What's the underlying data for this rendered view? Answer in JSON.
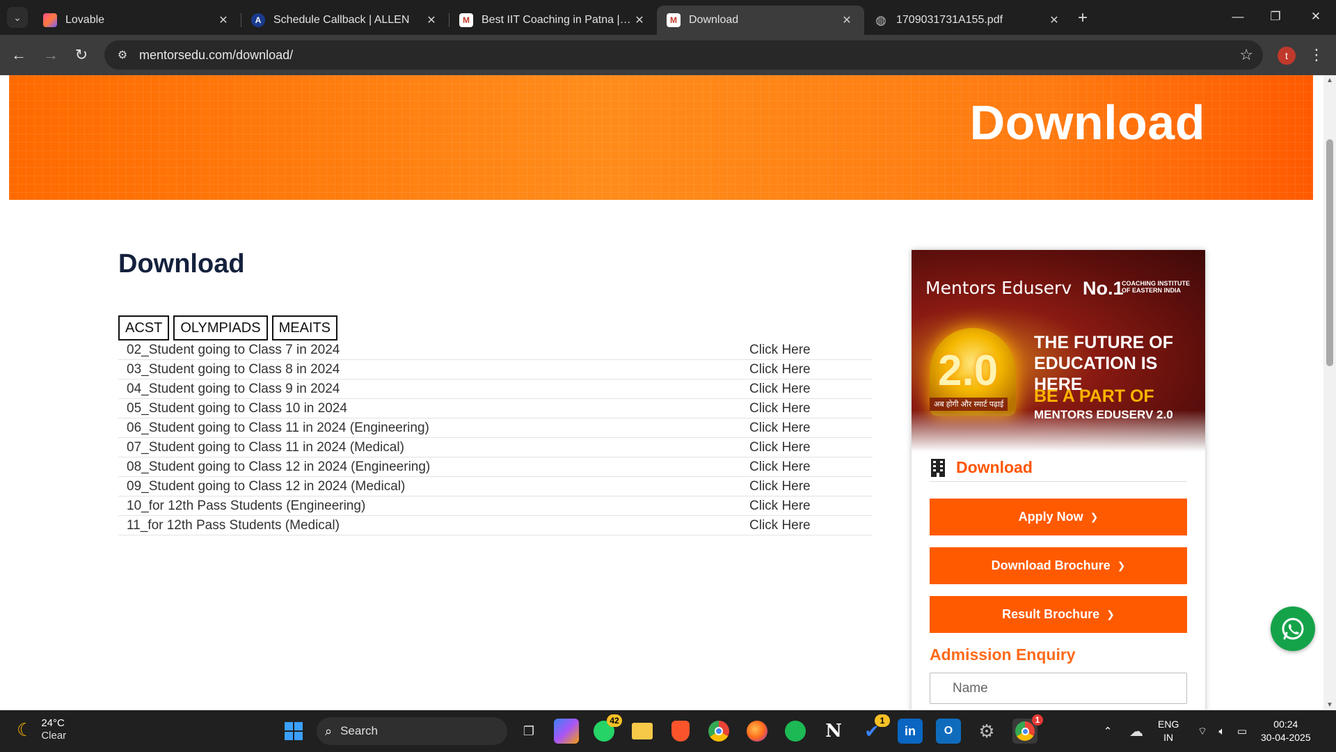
{
  "browser": {
    "tabs": [
      {
        "title": "Lovable",
        "active": false
      },
      {
        "title": "Schedule Callback | ALLEN",
        "active": false
      },
      {
        "title": "Best IIT Coaching in Patna | Best",
        "active": false
      },
      {
        "title": "Download",
        "active": true
      },
      {
        "title": "1709031731A155.pdf",
        "active": false
      }
    ],
    "url": "mentorsedu.com/download/",
    "profile_initial": "t"
  },
  "hero": {
    "title": "Download"
  },
  "main": {
    "heading": "Download",
    "categories": [
      "ACST",
      "OLYMPIADS",
      "MEAITS"
    ],
    "rows": [
      {
        "label": "02_Student going to Class 7 in 2024",
        "link": "Click Here"
      },
      {
        "label": "03_Student going to Class 8 in 2024",
        "link": "Click Here"
      },
      {
        "label": "04_Student going to Class 9 in 2024",
        "link": "Click Here"
      },
      {
        "label": "05_Student going to Class 10 in 2024",
        "link": "Click Here"
      },
      {
        "label": "06_Student going to Class 11 in 2024 (Engineering)",
        "link": "Click Here"
      },
      {
        "label": "07_Student going to Class 11 in 2024 (Medical)",
        "link": "Click Here"
      },
      {
        "label": "08_Student going to Class 12 in 2024 (Engineering)",
        "link": "Click Here"
      },
      {
        "label": "09_Student going to Class 12 in 2024 (Medical)",
        "link": "Click Here"
      },
      {
        "label": "10_for 12th Pass Students (Engineering)",
        "link": "Click Here"
      },
      {
        "label": "11_for 12th Pass Students (Medical)",
        "link": "Click Here"
      }
    ]
  },
  "sidebar": {
    "banner": {
      "brand": "Mentors Eduserv",
      "rank": "No.1",
      "rank_sub": "COACHING INSTITUTE OF EASTERN INDIA",
      "version": "2.0",
      "tagline_hindi": "अब होगी और स्मार्ट पढ़ाई",
      "headline": "THE FUTURE OF EDUCATION IS HERE",
      "subheadline": "BE A PART OF",
      "subheadline2": "MENTORS EDUSERV 2.0"
    },
    "download_label": "Download",
    "buttons": [
      "Apply Now",
      "Download Brochure",
      "Result Brochure"
    ],
    "enquiry_title": "Admission Enquiry",
    "name_placeholder": "Name"
  },
  "taskbar": {
    "temp": "24°C",
    "condition": "Clear",
    "search_label": "Search",
    "whatsapp_badge": "42",
    "todo_badge": "1",
    "chrome_badge": "1",
    "lang_top": "ENG",
    "lang_bottom": "IN",
    "time": "00:24",
    "date": "30-04-2025"
  },
  "colors": {
    "accent": "#ff5a00",
    "heading": "#14213d",
    "whatsapp": "#15a34a"
  }
}
